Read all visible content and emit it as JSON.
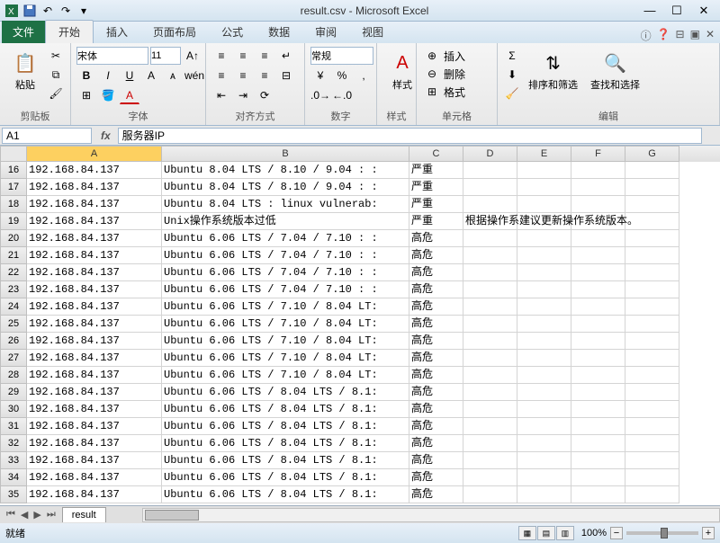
{
  "titlebar": {
    "title": "result.csv - Microsoft Excel"
  },
  "ribbon": {
    "file": "文件",
    "tabs": [
      "开始",
      "插入",
      "页面布局",
      "公式",
      "数据",
      "审阅",
      "视图"
    ],
    "active_tab": 0,
    "help_icons": [
      "ⓘ",
      "❓",
      "⊟",
      "▣",
      "✕"
    ]
  },
  "groups": {
    "clipboard": {
      "label": "剪贴板",
      "paste": "粘贴"
    },
    "font": {
      "label": "字体",
      "name": "宋体",
      "size": "11",
      "bold": "B",
      "italic": "I",
      "underline": "U"
    },
    "alignment": {
      "label": "对齐方式",
      "general": "常规"
    },
    "number": {
      "label": "数字"
    },
    "styles": {
      "label": "样式",
      "style_btn": "样式"
    },
    "cells": {
      "label": "单元格",
      "insert": "插入",
      "delete": "删除",
      "format": "格式"
    },
    "editing": {
      "label": "编辑",
      "sort": "排序和筛选",
      "find": "查找和选择"
    }
  },
  "formula_bar": {
    "name_box": "A1",
    "fx": "fx",
    "formula": "服务器IP"
  },
  "columns": [
    "A",
    "B",
    "C",
    "D",
    "E",
    "F",
    "G"
  ],
  "rows": [
    {
      "n": 16,
      "a": "192.168.84.137",
      "b": "Ubuntu 8.04 LTS / 8.10 / 9.04 : :",
      "c": "严重",
      "d": ""
    },
    {
      "n": 17,
      "a": "192.168.84.137",
      "b": "Ubuntu 8.04 LTS / 8.10 / 9.04 : :",
      "c": "严重",
      "d": ""
    },
    {
      "n": 18,
      "a": "192.168.84.137",
      "b": "Ubuntu 8.04 LTS : linux vulnerab:",
      "c": "严重",
      "d": ""
    },
    {
      "n": 19,
      "a": "192.168.84.137",
      "b": "Unix操作系统版本过低",
      "c": "严重",
      "d": "根据操作系建议更新操作系统版本。",
      "overflow": true
    },
    {
      "n": 20,
      "a": "192.168.84.137",
      "b": "Ubuntu 6.06 LTS / 7.04 / 7.10 : :",
      "c": "高危",
      "d": ""
    },
    {
      "n": 21,
      "a": "192.168.84.137",
      "b": "Ubuntu 6.06 LTS / 7.04 / 7.10 : :",
      "c": "高危",
      "d": ""
    },
    {
      "n": 22,
      "a": "192.168.84.137",
      "b": "Ubuntu 6.06 LTS / 7.04 / 7.10 : :",
      "c": "高危",
      "d": ""
    },
    {
      "n": 23,
      "a": "192.168.84.137",
      "b": "Ubuntu 6.06 LTS / 7.04 / 7.10 : :",
      "c": "高危",
      "d": ""
    },
    {
      "n": 24,
      "a": "192.168.84.137",
      "b": "Ubuntu 6.06 LTS / 7.10 / 8.04 LT:",
      "c": "高危",
      "d": ""
    },
    {
      "n": 25,
      "a": "192.168.84.137",
      "b": "Ubuntu 6.06 LTS / 7.10 / 8.04 LT:",
      "c": "高危",
      "d": ""
    },
    {
      "n": 26,
      "a": "192.168.84.137",
      "b": "Ubuntu 6.06 LTS / 7.10 / 8.04 LT:",
      "c": "高危",
      "d": ""
    },
    {
      "n": 27,
      "a": "192.168.84.137",
      "b": "Ubuntu 6.06 LTS / 7.10 / 8.04 LT:",
      "c": "高危",
      "d": ""
    },
    {
      "n": 28,
      "a": "192.168.84.137",
      "b": "Ubuntu 6.06 LTS / 7.10 / 8.04 LT:",
      "c": "高危",
      "d": ""
    },
    {
      "n": 29,
      "a": "192.168.84.137",
      "b": "Ubuntu 6.06 LTS / 8.04 LTS / 8.1:",
      "c": "高危",
      "d": ""
    },
    {
      "n": 30,
      "a": "192.168.84.137",
      "b": "Ubuntu 6.06 LTS / 8.04 LTS / 8.1:",
      "c": "高危",
      "d": ""
    },
    {
      "n": 31,
      "a": "192.168.84.137",
      "b": "Ubuntu 6.06 LTS / 8.04 LTS / 8.1:",
      "c": "高危",
      "d": ""
    },
    {
      "n": 32,
      "a": "192.168.84.137",
      "b": "Ubuntu 6.06 LTS / 8.04 LTS / 8.1:",
      "c": "高危",
      "d": ""
    },
    {
      "n": 33,
      "a": "192.168.84.137",
      "b": "Ubuntu 6.06 LTS / 8.04 LTS / 8.1:",
      "c": "高危",
      "d": ""
    },
    {
      "n": 34,
      "a": "192.168.84.137",
      "b": "Ubuntu 6.06 LTS / 8.04 LTS / 8.1:",
      "c": "高危",
      "d": ""
    },
    {
      "n": 35,
      "a": "192.168.84.137",
      "b": "Ubuntu 6.06 LTS / 8.04 LTS / 8.1:",
      "c": "高危",
      "d": ""
    }
  ],
  "sheet": {
    "name": "result"
  },
  "status": {
    "ready": "就绪",
    "zoom": "100%"
  }
}
